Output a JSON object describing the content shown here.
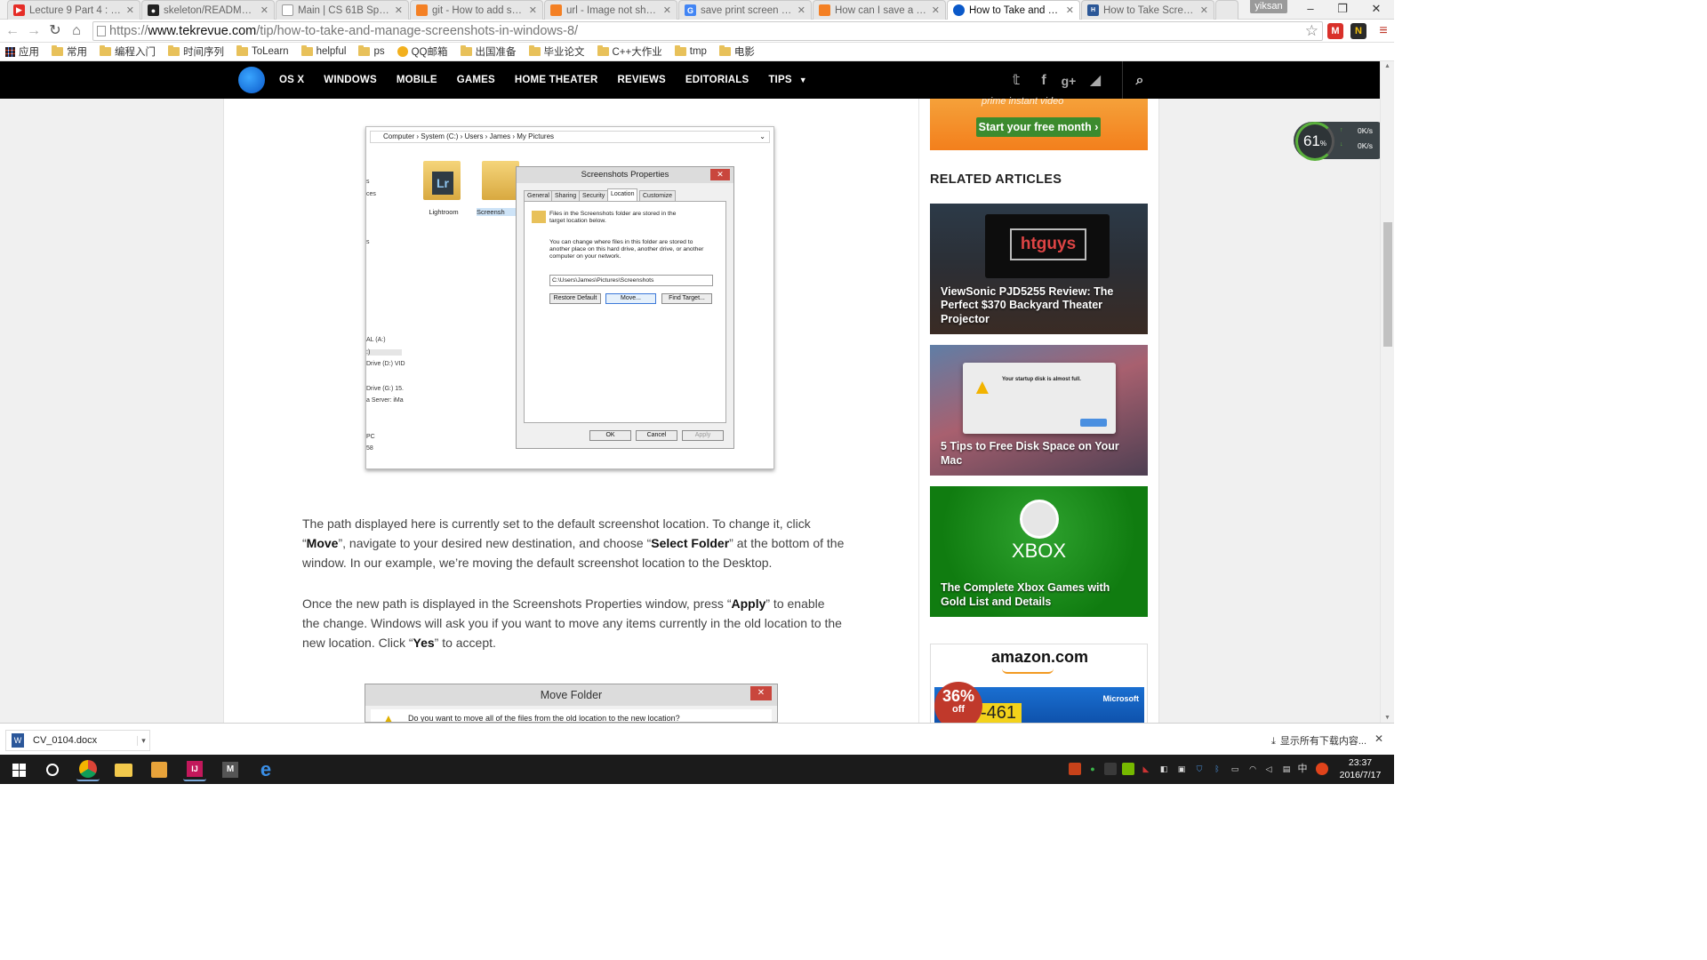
{
  "browser": {
    "tabs": [
      {
        "title": "Lecture 9 Part 4 : Casti",
        "fav_color": "#e52d27",
        "fav_glyph": "▶"
      },
      {
        "title": "skeleton/README.md",
        "fav_color": "#222222",
        "fav_glyph": "●"
      },
      {
        "title": "Main | CS 61B Spring 2",
        "fav_color": "#cccccc",
        "fav_glyph": ""
      },
      {
        "title": "git - How to add scree",
        "fav_color": "#f48024",
        "fav_glyph": ""
      },
      {
        "title": "url - Image not showin",
        "fav_color": "#f48024",
        "fav_glyph": ""
      },
      {
        "title": "save print screen to di",
        "fav_color": "#4285f4",
        "fav_glyph": "G"
      },
      {
        "title": "How can I save a scree",
        "fav_color": "#f48024",
        "fav_glyph": ""
      },
      {
        "title": "How to Take and Man",
        "fav_color": "#0b59c9",
        "fav_glyph": "●"
      },
      {
        "title": "How to Take Screensh",
        "fav_color": "#2b5797",
        "fav_glyph": "H"
      }
    ],
    "user": "yiksan",
    "url_scheme": "https://",
    "url_host": "www.tekrevue.com",
    "url_path": "/tip/how-to-take-and-manage-screenshots-in-windows-8/",
    "bookmarks": [
      "应用",
      "常用",
      "编程入门",
      "时间序列",
      "ToLearn",
      "helpful",
      "ps",
      "QQ邮箱",
      "出国准备",
      "毕业论文",
      "C++大作业",
      "tmp",
      "电影"
    ]
  },
  "site_nav": {
    "items": [
      "OS X",
      "WINDOWS",
      "MOBILE",
      "GAMES",
      "HOME THEATER",
      "REVIEWS",
      "EDITORIALS",
      "TIPS"
    ]
  },
  "figure1": {
    "breadcrumb": "Computer  ›  System (C:)  ›  Users  ›  James  ›  My Pictures",
    "left_labels": [
      "s",
      "ces",
      "s",
      "AL (A:)",
      ":)",
      "Drive (D:) VID",
      "Drive (G:) 15.",
      "a Server: iMa",
      "PC",
      "58"
    ],
    "folders": [
      "Lightroom",
      "Screensh"
    ],
    "dialog_title": "Screenshots Properties",
    "tabs": [
      "General",
      "Sharing",
      "Security",
      "Location",
      "Customize"
    ],
    "text1": "Files in the Screenshots folder are stored in the target location below.",
    "text2": "You can change where files in this folder are stored to another place on this hard drive, another drive, or another computer on your network.",
    "path": "C:\\Users\\James\\Pictures\\Screenshots",
    "btn_restore": "Restore Default",
    "btn_move": "Move...",
    "btn_find": "Find Target...",
    "btn_ok": "OK",
    "btn_cancel": "Cancel",
    "btn_apply": "Apply"
  },
  "article": {
    "p1_a": "The path displayed here is currently set to the default screenshot location. To change it, click “",
    "p1_b": "Move",
    "p1_c": "”, navigate to your desired new destination, and choose “",
    "p1_d": "Select Folder",
    "p1_e": "” at the bottom of the window. In our example, we’re moving the default screenshot location to the Desktop.",
    "p2_a": "Once the new path is displayed in the Screenshots Properties window, press “",
    "p2_b": "Apply",
    "p2_c": "” to enable the change. Windows will ask you if you want to move any items currently in the old location to the new location. Click “",
    "p2_d": "Yes",
    "p2_e": "” to accept."
  },
  "figure2": {
    "title": "Move Folder",
    "text": "Do you want to move all of the files from the old location to the new location?"
  },
  "sidebar": {
    "prime_text": "prime instant video",
    "prime_button": "Start your free month ›",
    "related_heading": "RELATED ARTICLES",
    "articles": [
      {
        "title": "ViewSonic PJD5255 Review: The Perfect $370 Backyard Theater Projector",
        "overlay": "htguys"
      },
      {
        "title": "5 Tips to Free Disk Space on Your Mac",
        "overlay": "Your startup disk is almost full."
      },
      {
        "title": "The Complete Xbox Games with Gold List and Details",
        "overlay": "XBOX"
      }
    ],
    "ad_logo": "amazon.com",
    "ad_badge_pct": "36%",
    "ad_badge_off": "off",
    "ad_brand": "Microsoft",
    "ad_number": "-461"
  },
  "net_widget": {
    "percent": "61",
    "up": "0K/s",
    "down": "0K/s"
  },
  "download": {
    "file": "CV_0104.docx",
    "show_all": "显示所有下载内容..."
  },
  "taskbar": {
    "time": "23:37",
    "date": "2016/7/17",
    "ime": "中"
  },
  "colors": {
    "nav_bg": "#000000",
    "prime_orange": "#f37f1c",
    "start_green": "#3c8b2e",
    "xbox_green": "#107c10"
  }
}
